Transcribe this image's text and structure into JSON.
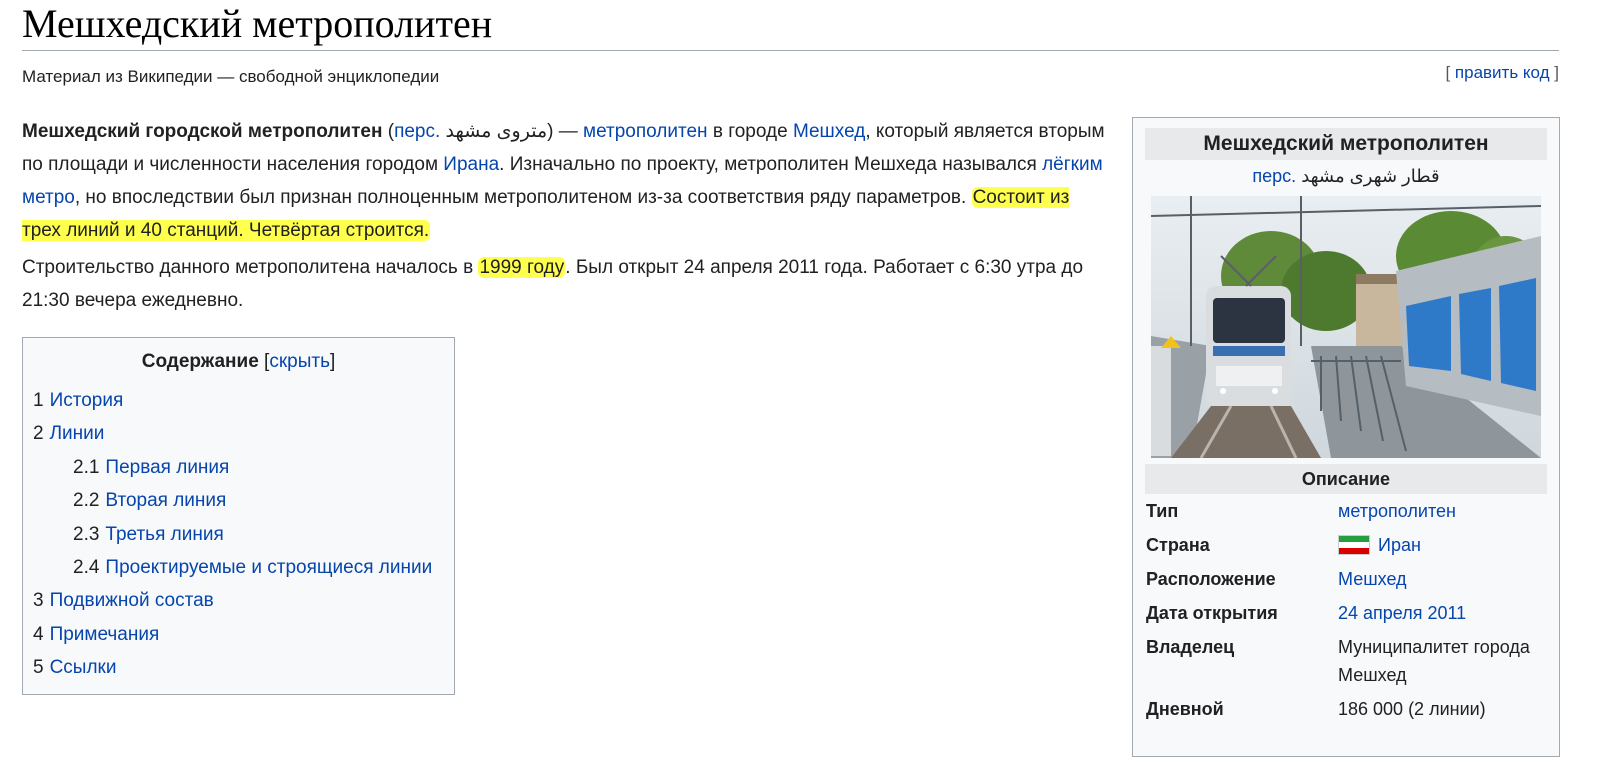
{
  "page": {
    "title": "Мешхедский метрополитен",
    "tagline": "Материал из Википедии — свободной энциклопедии",
    "edit_link": "править код"
  },
  "article": {
    "p1": {
      "bold": "Мешхедский городской метрополитен",
      "lang_link": "перс.",
      "persian": "متروی مشهد",
      "dash": ") — ",
      "link_metro": "метрополитен",
      "t1": " в городе ",
      "link_city": "Мешхед",
      "t2": ", который является вторым по площади и численности населения городом ",
      "link_iran": "Ирана",
      "t3": ". Изначально по проекту, метрополитен Мешхеда назывался ",
      "link_light": "лёгким метро",
      "t4": ", но впоследствии был признан полноценным метрополитеном из-за соответствия ряду параметров. ",
      "highlight": "Состоит из трех линий и 40 станций. Четвёртая строится."
    },
    "p2": {
      "t1": "Строительство данного метрополитена началось в ",
      "highlight": "1999 году",
      "t2": ". Был открыт 24 апреля 2011 года. Работает с 6:30 утра до 21:30 вечера ежедневно."
    }
  },
  "toc": {
    "title": "Содержание",
    "toggle": "скрыть",
    "items": [
      {
        "num": "1",
        "label": "История"
      },
      {
        "num": "2",
        "label": "Линии"
      },
      {
        "num": "2.1",
        "label": "Первая линия"
      },
      {
        "num": "2.2",
        "label": "Вторая линия"
      },
      {
        "num": "2.3",
        "label": "Третья линия"
      },
      {
        "num": "2.4",
        "label": "Проектируемые и строящиеся линии"
      },
      {
        "num": "3",
        "label": "Подвижной состав"
      },
      {
        "num": "4",
        "label": "Примечания"
      },
      {
        "num": "5",
        "label": "Ссылки"
      }
    ]
  },
  "infobox": {
    "title": "Мешхедский метрополитен",
    "sub_lang": "перс.",
    "sub_name": "قطار شهری مشهد",
    "section": "Описание",
    "rows": [
      {
        "key": "Тип",
        "value": "метрополитен"
      },
      {
        "key": "Страна",
        "value": "Иран"
      },
      {
        "key": "Расположение",
        "value": "Мешхед"
      },
      {
        "key": "Дата открытия",
        "value": "24 апреля 2011"
      },
      {
        "key": "Владелец",
        "value": "Муниципалитет города Мешхед"
      },
      {
        "key": "Дневной",
        "value": "186 000 (2 линии)"
      }
    ],
    "flag_colors": {
      "green": "#239f40",
      "white": "#ffffff",
      "red": "#da0000"
    }
  },
  "colors": {
    "link": "#0645ad",
    "highlight": "#ffff4d",
    "border": "#a2a9b1"
  }
}
